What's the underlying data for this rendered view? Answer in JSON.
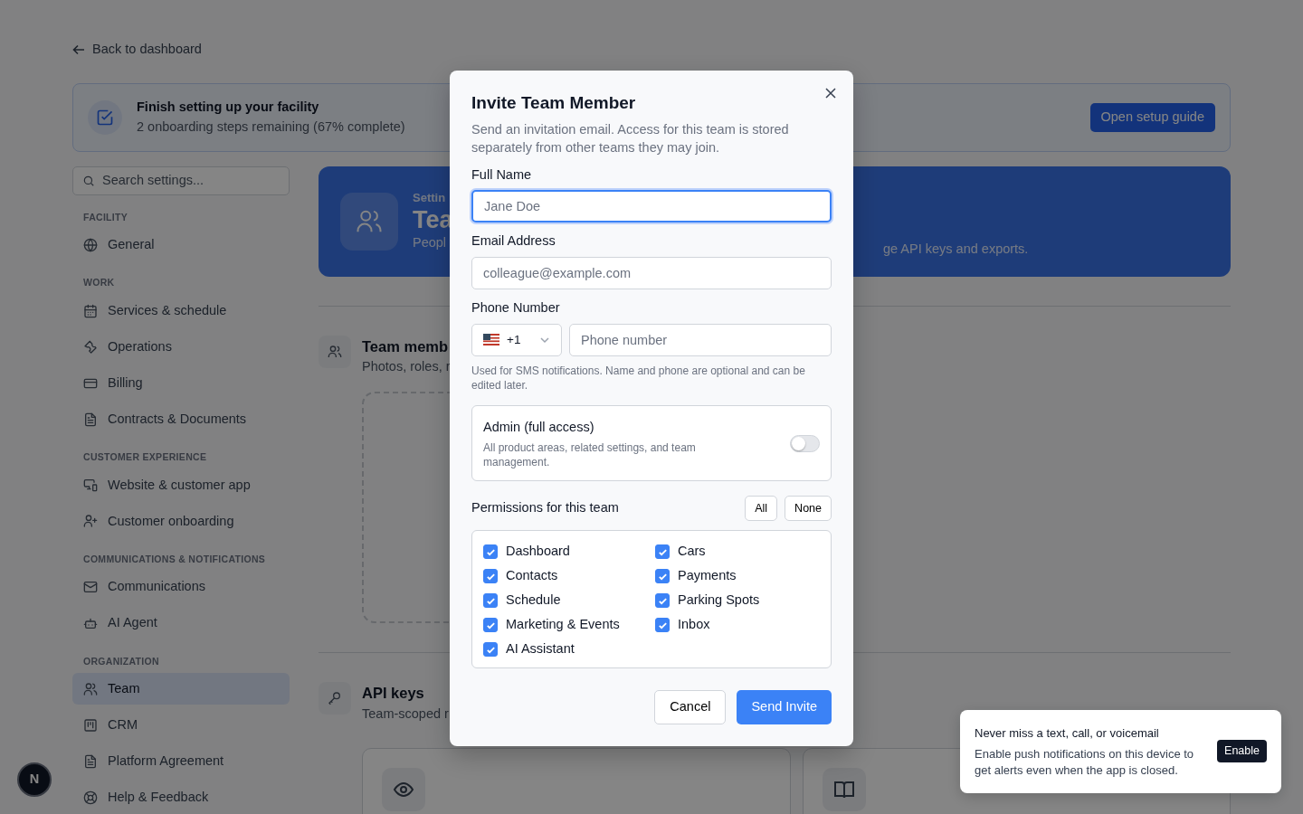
{
  "back_link": {
    "label": "Back to dashboard"
  },
  "setup_banner": {
    "title": "Finish setting up your facility",
    "subtitle": "2 onboarding steps remaining (67% complete)",
    "button": "Open setup guide"
  },
  "sidebar": {
    "search_placeholder": "Search settings...",
    "sections": [
      {
        "heading": "FACILITY",
        "items": [
          {
            "label": "General",
            "selected": false
          }
        ]
      },
      {
        "heading": "WORK",
        "items": [
          {
            "label": "Services & schedule",
            "selected": false
          },
          {
            "label": "Operations",
            "selected": false
          },
          {
            "label": "Billing",
            "selected": false
          },
          {
            "label": "Contracts & Documents",
            "selected": false
          }
        ]
      },
      {
        "heading": "CUSTOMER EXPERIENCE",
        "items": [
          {
            "label": "Website & customer app",
            "selected": false
          },
          {
            "label": "Customer onboarding",
            "selected": false
          }
        ]
      },
      {
        "heading": "COMMUNICATIONS & NOTIFICATIONS",
        "items": [
          {
            "label": "Communications",
            "selected": false
          },
          {
            "label": "AI Agent",
            "selected": false
          }
        ]
      },
      {
        "heading": "ORGANIZATION",
        "items": [
          {
            "label": "Team",
            "selected": true
          },
          {
            "label": "CRM",
            "selected": false
          },
          {
            "label": "Platform Agreement",
            "selected": false
          },
          {
            "label": "Help & Feedback",
            "selected": false
          }
        ]
      }
    ]
  },
  "hero": {
    "eyebrow": "Settin",
    "title": "Tea",
    "description_left": "Peopl",
    "description_right": "ge API keys and exports."
  },
  "sections": [
    {
      "title": "Team memb",
      "subtitle": "Photos, roles, r"
    },
    {
      "title": "API keys",
      "subtitle": "Team-scoped r"
    }
  ],
  "avatar": {
    "initial": "N"
  },
  "modal": {
    "title": "Invite Team Member",
    "description": "Send an invitation email. Access for this team is stored separately from other teams they may join.",
    "full_name": {
      "label": "Full Name",
      "placeholder": "Jane Doe",
      "focused": true
    },
    "email": {
      "label": "Email Address",
      "placeholder": "colleague@example.com"
    },
    "phone": {
      "label": "Phone Number",
      "country_code": "+1",
      "placeholder": "Phone number",
      "hint": "Used for SMS notifications. Name and phone are optional and can be edited later."
    },
    "admin": {
      "title": "Admin (full access)",
      "description": "All product areas, related settings, and team management.",
      "on": false
    },
    "permissions": {
      "title": "Permissions for this team",
      "all_button": "All",
      "none_button": "None",
      "items": [
        {
          "label": "Dashboard",
          "checked": true
        },
        {
          "label": "Cars",
          "checked": true
        },
        {
          "label": "Contacts",
          "checked": true
        },
        {
          "label": "Payments",
          "checked": true
        },
        {
          "label": "Schedule",
          "checked": true
        },
        {
          "label": "Parking Spots",
          "checked": true
        },
        {
          "label": "Marketing & Events",
          "checked": true
        },
        {
          "label": "Inbox",
          "checked": true
        },
        {
          "label": "AI Assistant",
          "checked": true
        }
      ]
    },
    "cancel_button": "Cancel",
    "submit_button": "Send Invite"
  },
  "toast": {
    "title": "Never miss a text, call, or voicemail",
    "body": "Enable push notifications on this device to get alerts even when the app is closed.",
    "button": "Enable"
  }
}
